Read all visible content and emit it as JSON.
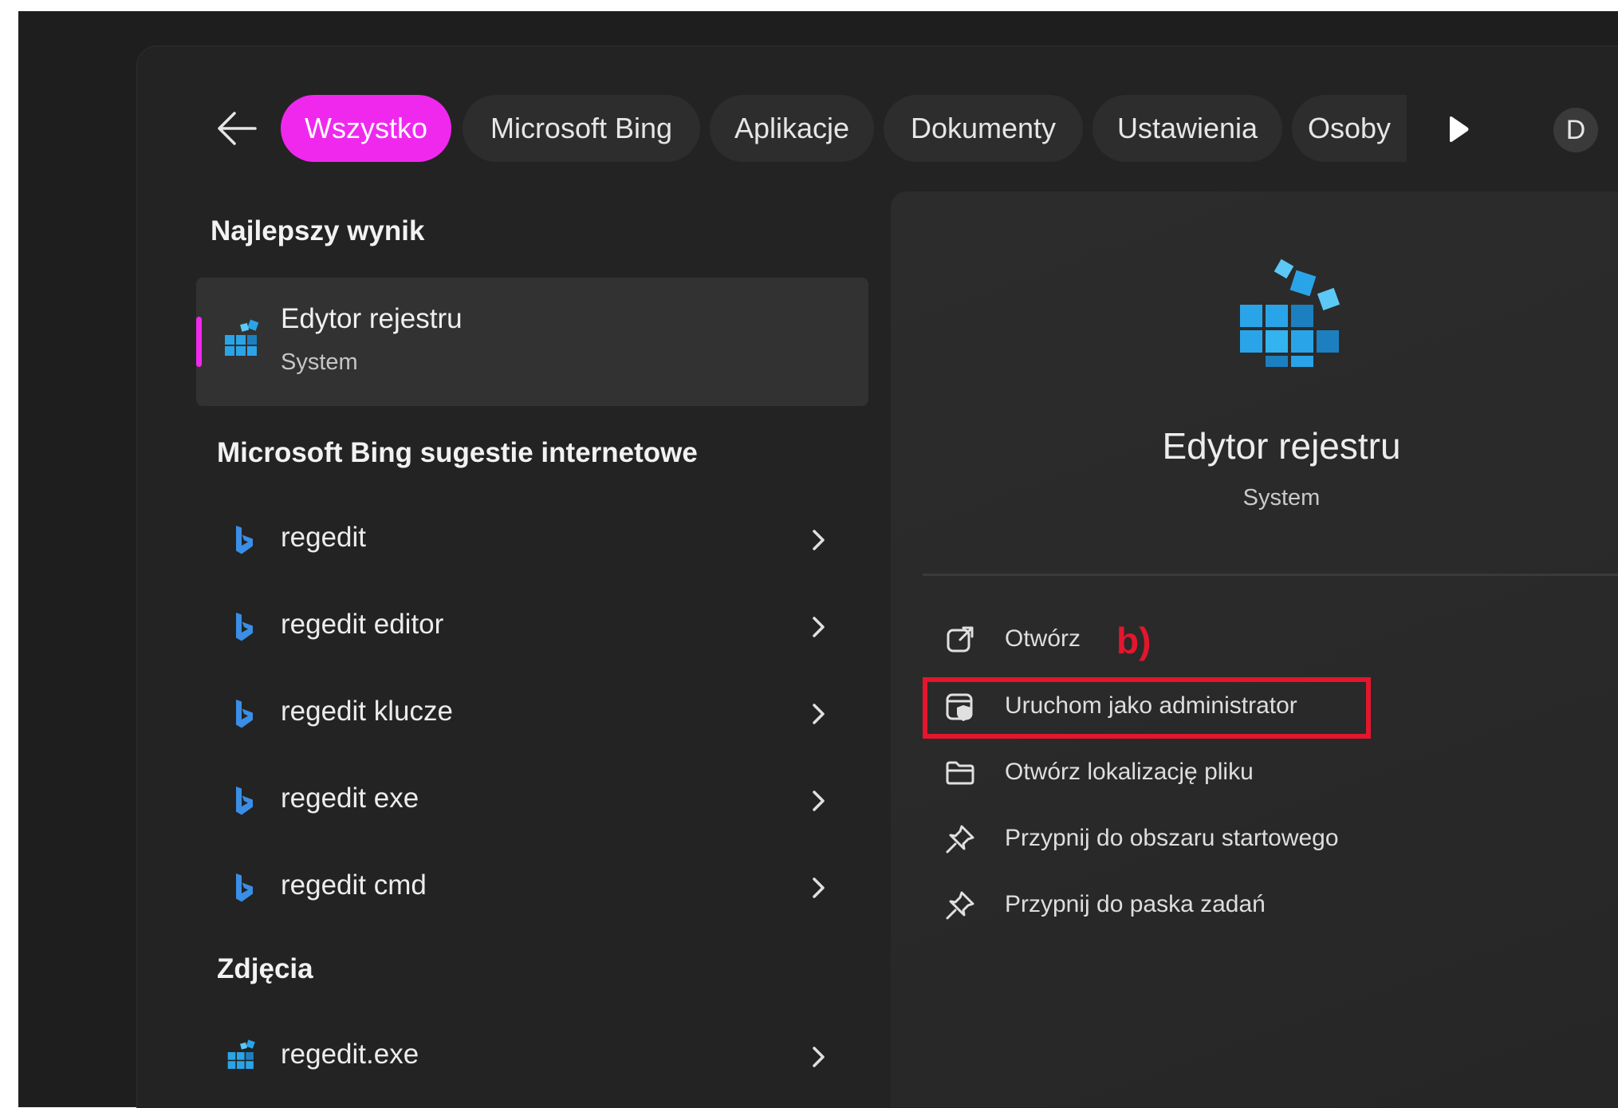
{
  "colors": {
    "accent": "#f028ee",
    "highlight": "#e3162d",
    "bing_blue": "#3a8ee6",
    "regedit_blue": "#2aa4e8"
  },
  "tabs": [
    {
      "label": "Wszystko",
      "active": true
    },
    {
      "label": "Microsoft Bing"
    },
    {
      "label": "Aplikacje"
    },
    {
      "label": "Dokumenty"
    },
    {
      "label": "Ustawienia"
    },
    {
      "label": "Osoby"
    }
  ],
  "icons": {
    "back": "arrow-left-icon",
    "more": "play-triangle-icon",
    "app": "registry-cubes-icon",
    "bing": "bing-logo-icon"
  },
  "avatar": "D",
  "best": {
    "heading": "Najlepszy wynik",
    "title": "Edytor rejestru",
    "subtitle": "System"
  },
  "bing": {
    "heading": "Microsoft Bing sugestie internetowe",
    "items": [
      "regedit",
      "regedit editor",
      "regedit klucze",
      "regedit exe",
      "regedit cmd"
    ]
  },
  "photos": {
    "heading": "Zdjęcia",
    "items": [
      "regedit.exe"
    ]
  },
  "detail": {
    "title": "Edytor rejestru",
    "subtitle": "System",
    "annotation": "b)",
    "actions": [
      {
        "label": "Otwórz",
        "icon": "open-external-icon"
      },
      {
        "label": "Uruchom jako administrator",
        "icon": "run-as-admin-icon",
        "highlighted": true
      },
      {
        "label": "Otwórz lokalizację pliku",
        "icon": "folder-icon"
      },
      {
        "label": "Przypnij do obszaru startowego",
        "icon": "pin-icon"
      },
      {
        "label": "Przypnij do paska zadań",
        "icon": "pin-icon"
      }
    ]
  }
}
